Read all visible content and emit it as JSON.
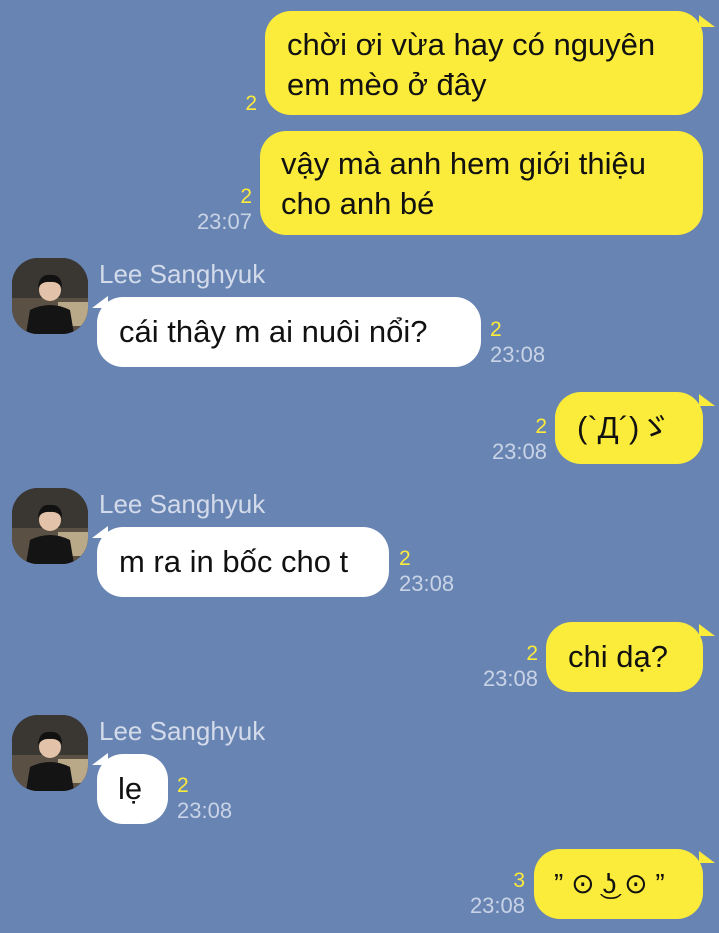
{
  "chat": {
    "colors": {
      "background": "#6884b3",
      "outgoing_bubble": "#fbeb3a",
      "incoming_bubble": "#ffffff",
      "unread_count": "#fbeb3a"
    },
    "contact": {
      "name": "Lee Sanghyuk",
      "avatar_icon": "profile-photo-icon"
    },
    "messages": [
      {
        "direction": "out",
        "text_lines": [
          "chời ơi vừa hay có nguyên",
          "em mèo ở đây"
        ],
        "unread": "2",
        "time": ""
      },
      {
        "direction": "out",
        "text_lines": [
          "vậy mà anh hem giới thiệu",
          "cho anh bé"
        ],
        "unread": "2",
        "time": "23:07"
      },
      {
        "direction": "in",
        "sender": "Lee Sanghyuk",
        "text": "cái thây m ai nuôi nổi?",
        "unread": "2",
        "time": "23:08"
      },
      {
        "direction": "out",
        "text": "(`Д´)ゞ",
        "unread": "2",
        "time": "23:08"
      },
      {
        "direction": "in",
        "sender": "Lee Sanghyuk",
        "text": "m ra in bốc cho t",
        "unread": "2",
        "time": "23:08"
      },
      {
        "direction": "out",
        "text": "chi dạ?",
        "unread": "2",
        "time": "23:08"
      },
      {
        "direction": "in",
        "sender": "Lee Sanghyuk",
        "text": "lẹ",
        "unread": "2",
        "time": "23:08"
      },
      {
        "direction": "out",
        "text": "” ⊙ ͜ʖ ⊙ ”",
        "unread": "3",
        "time": "23:08"
      }
    ]
  }
}
